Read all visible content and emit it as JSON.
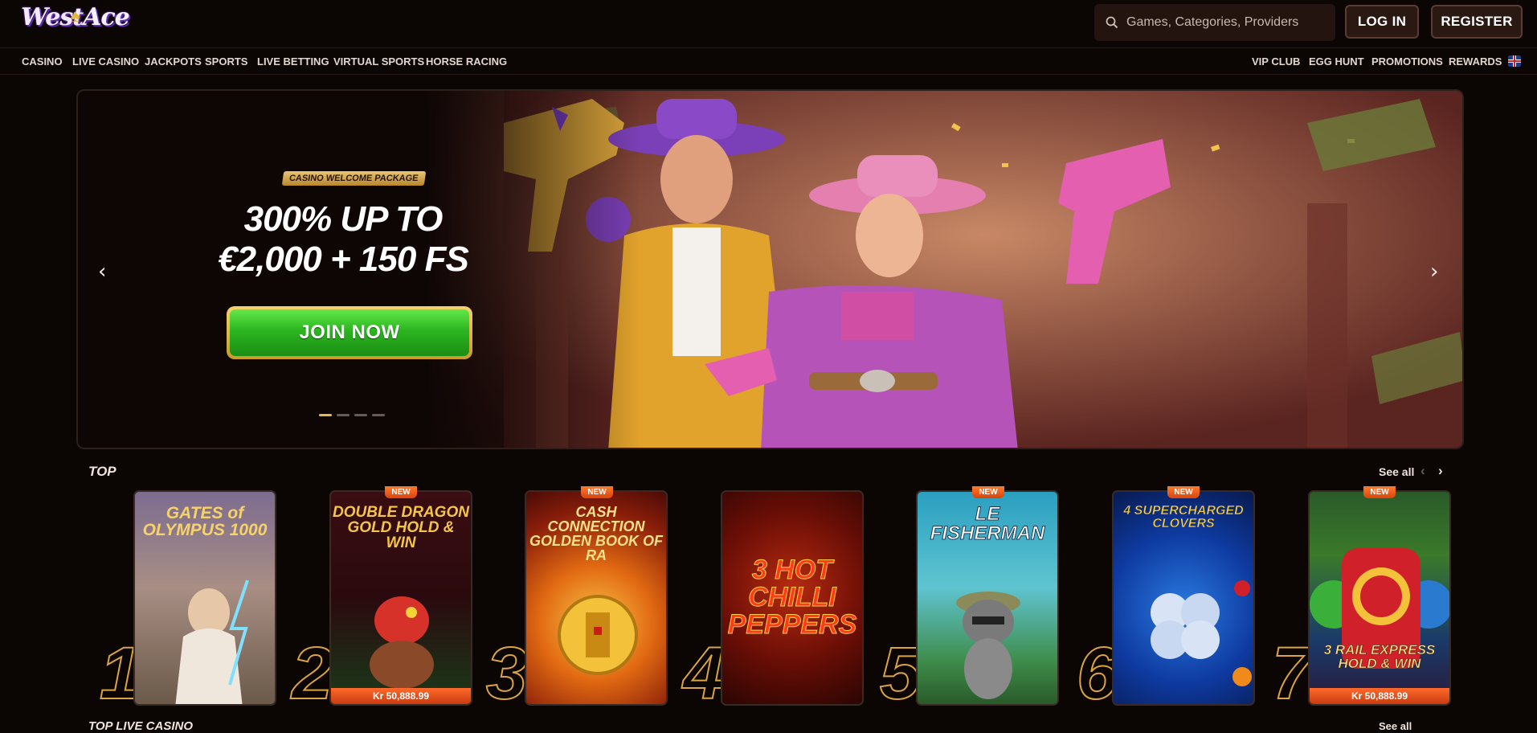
{
  "brand": {
    "logo_text_1": "West",
    "logo_text_2": "Ace"
  },
  "header": {
    "search_placeholder": "Games, Categories, Providers",
    "login_label": "LOG IN",
    "register_label": "REGISTER"
  },
  "nav": {
    "left": [
      "CASINO",
      "LIVE CASINO",
      "JACKPOTS",
      "SPORTS",
      "LIVE BETTING",
      "VIRTUAL SPORTS",
      "HORSE RACING"
    ],
    "right": [
      "VIP CLUB",
      "EGG HUNT",
      "PROMOTIONS",
      "REWARDS"
    ],
    "language_icon": "uk-flag-icon"
  },
  "hero": {
    "badge": "CASINO WELCOME PACKAGE",
    "title_line1": "300% UP TO",
    "title_line2": "€2,000 + 150 FS",
    "cta": "JOIN NOW",
    "slide_count": 4,
    "active_slide": 1
  },
  "top_section": {
    "title": "TOP",
    "see_all": "See all",
    "games": [
      {
        "rank": "1",
        "title": "GATES of OLYMPUS 1000",
        "new": false,
        "jackpot": ""
      },
      {
        "rank": "2",
        "title": "DOUBLE DRAGON GOLD HOLD & WIN",
        "new": true,
        "jackpot": "Kr 50,888.99"
      },
      {
        "rank": "3",
        "title": "CASH CONNECTION GOLDEN BOOK OF RA",
        "new": true,
        "jackpot": ""
      },
      {
        "rank": "4",
        "title": "3 HOT CHILLI PEPPERS",
        "new": false,
        "jackpot": ""
      },
      {
        "rank": "5",
        "title": "LE FISHERMAN",
        "new": true,
        "jackpot": ""
      },
      {
        "rank": "6",
        "title": "4 SUPERCHARGED CLOVERS",
        "new": true,
        "jackpot": ""
      },
      {
        "rank": "7",
        "title": "3 RAIL EXPRESS HOLD & WIN",
        "new": true,
        "jackpot": "Kr 50,888.99"
      }
    ],
    "new_label": "NEW"
  },
  "next_section": {
    "title": "TOP LIVE CASINO",
    "see_all": "See all"
  },
  "colors": {
    "accent_gold": "#d9a441",
    "join_green": "#2cb520",
    "new_orange": "#e8531a",
    "background": "#0b0504"
  }
}
